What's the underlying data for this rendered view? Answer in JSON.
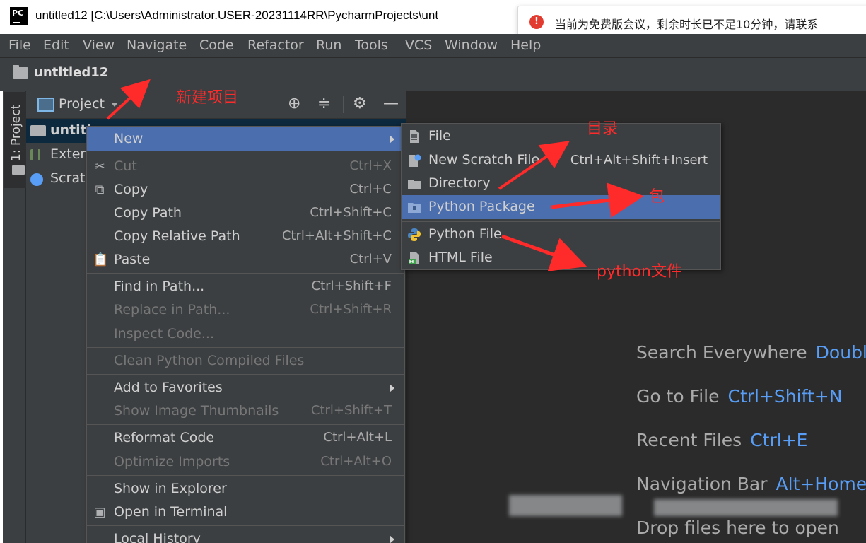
{
  "window": {
    "title": "untitled12 [C:\\Users\\Administrator.USER-20231114RR\\PycharmProjects\\unt",
    "logo_text": "PC"
  },
  "toast": {
    "icon": "!",
    "message": "当前为免费版会议，剩余时长已不足10分钟，请联系"
  },
  "menubar": [
    "File",
    "Edit",
    "View",
    "Navigate",
    "Code",
    "Refactor",
    "Run",
    "Tools",
    "VCS",
    "Window",
    "Help"
  ],
  "navbar": {
    "project": "untitled12"
  },
  "side_stripe": {
    "tab": "1: Project"
  },
  "project_panel": {
    "title": "Project",
    "tree": [
      "untitl",
      "Extern",
      "Scratc"
    ]
  },
  "context_menu": {
    "items": [
      {
        "label": "New",
        "shortcut": "",
        "submenu": true
      },
      {
        "label": "Cut",
        "shortcut": "Ctrl+X"
      },
      {
        "label": "Copy",
        "shortcut": "Ctrl+C"
      },
      {
        "label": "Copy Path",
        "shortcut": "Ctrl+Shift+C"
      },
      {
        "label": "Copy Relative Path",
        "shortcut": "Ctrl+Alt+Shift+C"
      },
      {
        "label": "Paste",
        "shortcut": "Ctrl+V"
      },
      {
        "label": "Find in Path...",
        "shortcut": "Ctrl+Shift+F"
      },
      {
        "label": "Replace in Path...",
        "shortcut": "Ctrl+Shift+R"
      },
      {
        "label": "Inspect Code...",
        "shortcut": ""
      },
      {
        "label": "Clean Python Compiled Files",
        "shortcut": ""
      },
      {
        "label": "Add to Favorites",
        "shortcut": "",
        "submenu": true
      },
      {
        "label": "Show Image Thumbnails",
        "shortcut": "Ctrl+Shift+T"
      },
      {
        "label": "Reformat Code",
        "shortcut": "Ctrl+Alt+L"
      },
      {
        "label": "Optimize Imports",
        "shortcut": "Ctrl+Alt+O"
      },
      {
        "label": "Show in Explorer",
        "shortcut": ""
      },
      {
        "label": "Open in Terminal",
        "shortcut": ""
      },
      {
        "label": "Local History",
        "shortcut": "",
        "submenu": true
      }
    ]
  },
  "new_submenu": {
    "items": [
      {
        "label": "File",
        "shortcut": ""
      },
      {
        "label": "New Scratch File",
        "shortcut": "Ctrl+Alt+Shift+Insert"
      },
      {
        "label": "Directory",
        "shortcut": ""
      },
      {
        "label": "Python Package",
        "shortcut": ""
      },
      {
        "label": "Python File",
        "shortcut": ""
      },
      {
        "label": "HTML File",
        "shortcut": ""
      }
    ]
  },
  "editor_hints": [
    {
      "label": "Search Everywhere",
      "key": "Double"
    },
    {
      "label": "Go to File",
      "key": "Ctrl+Shift+N"
    },
    {
      "label": "Recent Files",
      "key": "Ctrl+E"
    },
    {
      "label": "Navigation Bar",
      "key": "Alt+Home"
    },
    {
      "label": "Drop files here to open",
      "key": ""
    }
  ],
  "annotations": {
    "new_project": "新建项目",
    "directory": "目录",
    "package": "包",
    "python_file": "python文件"
  },
  "colors": {
    "annotation": "#ff2a2a",
    "highlight": "#4b6eaf",
    "shortcut_key": "#589df6"
  }
}
